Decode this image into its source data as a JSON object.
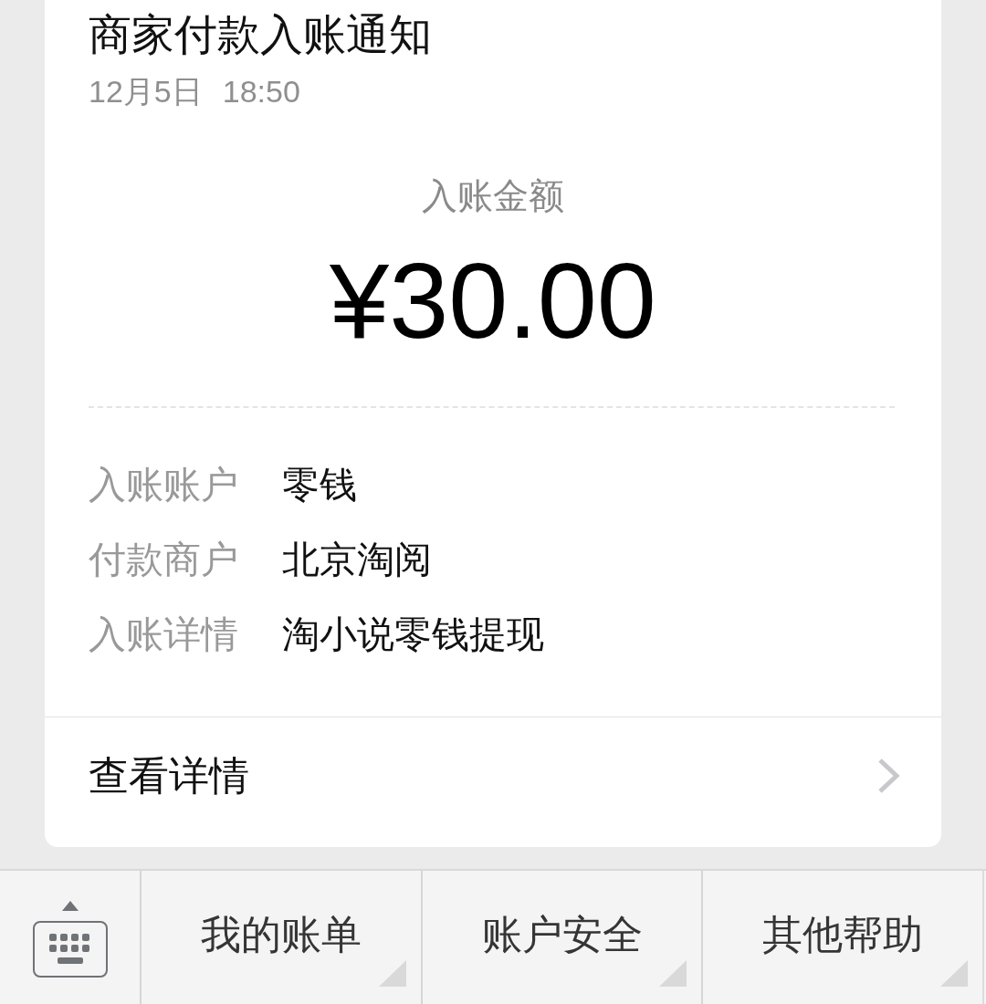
{
  "notice": {
    "title": "商家付款入账通知",
    "date": "12月5日",
    "time": "18:50",
    "amount_label": "入账金额",
    "amount": "¥30.00",
    "details": [
      {
        "label": "入账账户",
        "value": "零钱"
      },
      {
        "label": "付款商户",
        "value": "北京淘阅"
      },
      {
        "label": "入账详情",
        "value": "淘小说零钱提现"
      }
    ],
    "link": "查看详情"
  },
  "menu_bar": {
    "items": [
      {
        "label": "我的账单",
        "submenu": true
      },
      {
        "label": "账户安全",
        "submenu": true
      },
      {
        "label": "其他帮助",
        "submenu": true
      }
    ]
  }
}
